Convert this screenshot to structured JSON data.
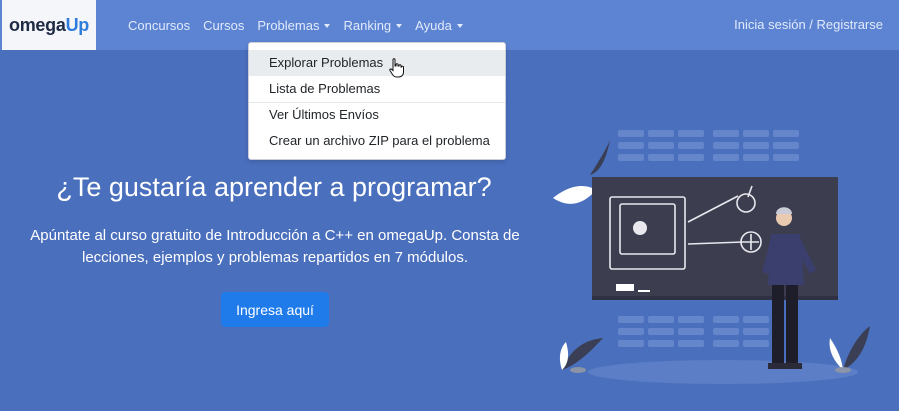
{
  "header": {
    "logo_part1": "omega",
    "logo_part2": "Up",
    "nav": {
      "contests": "Concursos",
      "courses": "Cursos",
      "problems": "Problemas",
      "ranking": "Ranking",
      "help": "Ayuda"
    },
    "login": "Inicia sesión / Registrarse"
  },
  "dropdown": {
    "items": [
      {
        "label": "Explorar Problemas",
        "active": true
      },
      {
        "label": "Lista de Problemas",
        "active": false
      },
      {
        "label": "Ver Últimos Envíos",
        "active": false
      },
      {
        "label": "Crear un archivo ZIP para el problema",
        "active": false
      }
    ]
  },
  "hero": {
    "title": "¿Te gustaría aprender a programar?",
    "text": "Apúntate al curso gratuito de Introducción a C++ en omegaUp. Consta de lecciones, ejemplos y problemas repartidos en 7 módulos.",
    "button": "Ingresa aquí"
  },
  "colors": {
    "page_bg": "#4a6fbd",
    "navbar": "#5c84d2",
    "primary_button": "#1f7bea",
    "chalkboard": "#3d3d50"
  },
  "icons": {
    "cursor": "hand-pointer-icon",
    "illustration": "teacher-chalkboard-illustration"
  }
}
